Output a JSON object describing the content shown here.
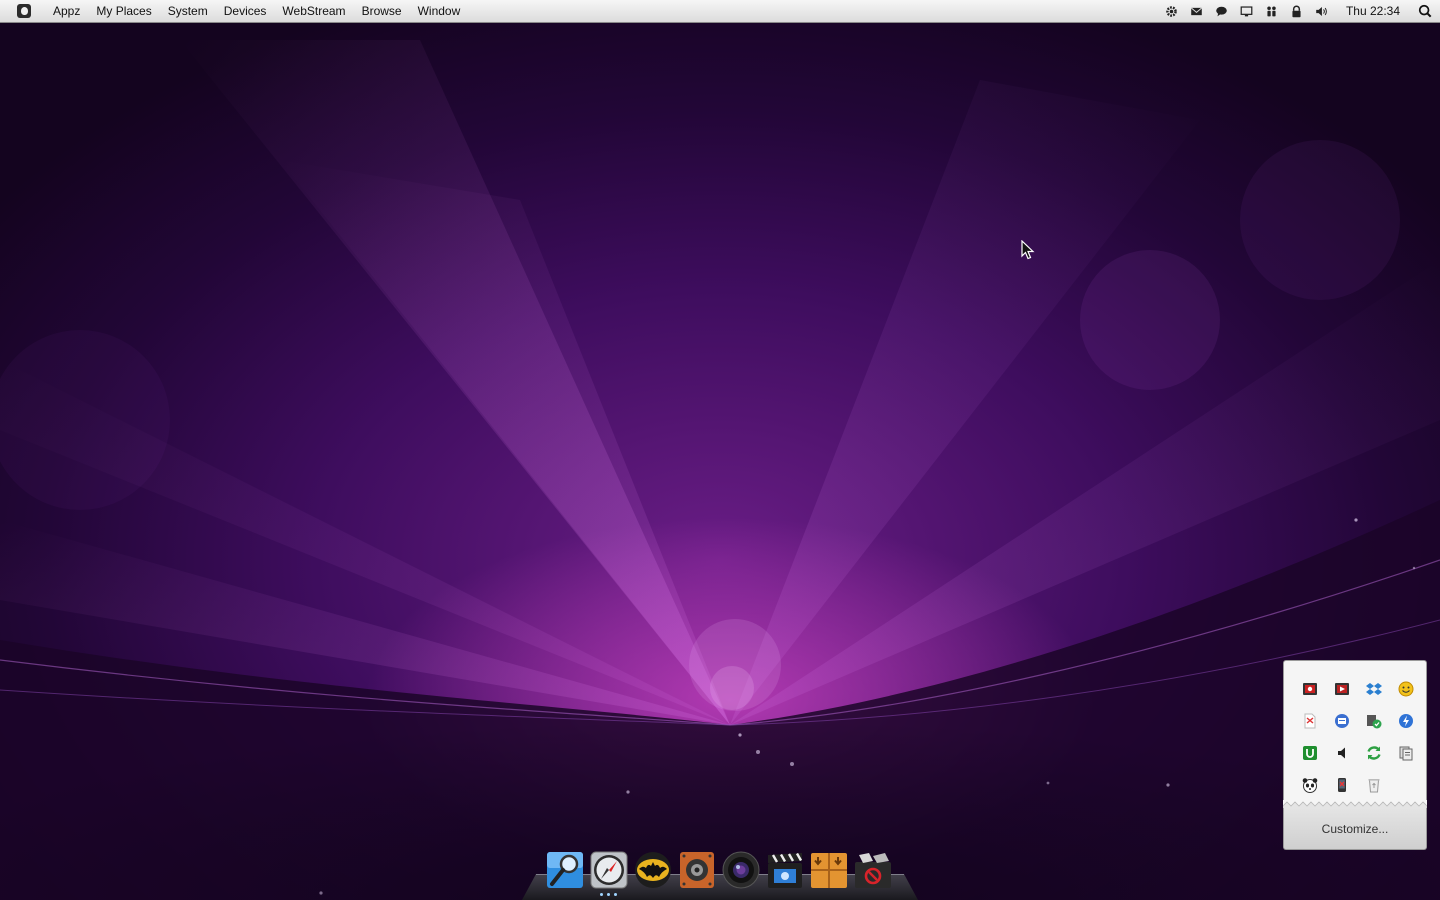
{
  "menubar": {
    "apple_icon": "apple-logo-icon",
    "menus": [
      "Appz",
      "My Places",
      "System",
      "Devices",
      "WebStream",
      "Browse",
      "Window"
    ],
    "status_icons": [
      "gear-icon",
      "mail-icon",
      "chat-bubble-icon",
      "display-icon",
      "users-icon",
      "lock-icon",
      "volume-icon"
    ],
    "clock": "Thu 22:34",
    "spotlight_icon": "spotlight-search-icon"
  },
  "tray_popup": {
    "icons": [
      "media-player-icon",
      "media-player-alt-icon",
      "dropbox-icon",
      "emoticon-icon",
      "pdf-document-icon",
      "printer-icon",
      "security-shield-icon",
      "power-icon",
      "utorrent-icon",
      "speaker-icon",
      "sync-icon",
      "clipboard-icon",
      "panda-antivirus-icon",
      "phone-icon",
      "recycle-bin-icon"
    ],
    "customize_label": "Customize..."
  },
  "dock": {
    "items": [
      "finder-magnifier-icon",
      "safari-compass-icon",
      "batman-game-icon",
      "speaker-system-icon",
      "camera-lens-icon",
      "video-clapperboard-icon",
      "downloads-box-icon",
      "trash-utility-icon"
    ]
  },
  "colors": {
    "wallpaper_center": "#c24bc4",
    "wallpaper_mid": "#5a167a",
    "wallpaper_edge": "#14041f",
    "menubar_top": "#f6f6f6",
    "menubar_bottom": "#dcdcdc"
  }
}
